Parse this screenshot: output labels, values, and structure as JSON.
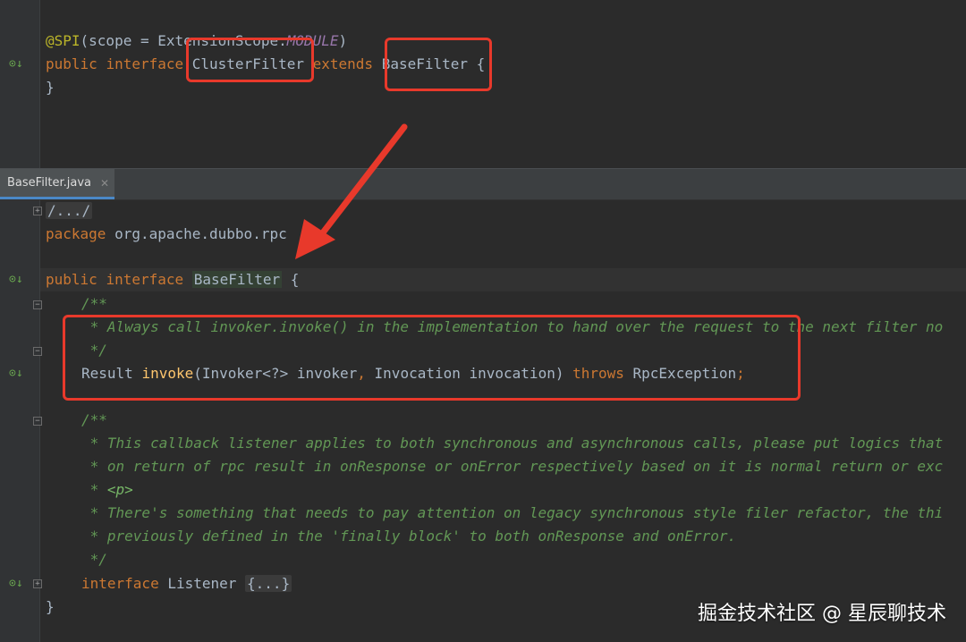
{
  "top_pane": {
    "line_annotation": {
      "at": "@SPI",
      "open": "(scope = ExtensionScope.",
      "field": "MODULE",
      "close": ")"
    },
    "line_decl": {
      "kw1": "public ",
      "kw2": "interface ",
      "name": "ClusterFilter",
      "kw3": " extends ",
      "parent": "BaseFilter",
      "brace": " {"
    },
    "line_close": "}"
  },
  "tab": {
    "label": "BaseFilter.java",
    "close_glyph": "✕"
  },
  "bottom_pane": {
    "collapsed_header": "/.../",
    "package_kw": "package ",
    "package_name": "org.apache.dubbo.rpc",
    "decl": {
      "kw1": "public ",
      "kw2": "interface ",
      "name": "BaseFilter",
      "brace": " {"
    },
    "doc1": {
      "open": "/**",
      "line1": " * Always call invoker.invoke() in the implementation to hand over the request to the next filter no",
      "close": " */"
    },
    "method": {
      "ret": "Result ",
      "name": "invoke",
      "params": "(Invoker<?> invoker",
      "comma": ",",
      "params2": " Invocation invocation) ",
      "throws_kw": "throws",
      "exc": " RpcException",
      "semi": ";"
    },
    "doc2": {
      "open": "/**",
      "line1": " * This callback listener applies to both synchronous and asynchronous calls, please put logics that",
      "line2": " * on return of rpc result in onResponse or onError respectively based on it is normal return or exc",
      "line3_star": " * ",
      "line3_tag": "<p>",
      "line4": " * There's something that needs to pay attention on legacy synchronous style filer refactor, the thi",
      "line5": " * previously defined in the 'finally block' to both onResponse and onError.",
      "close": " */"
    },
    "listener": {
      "kw": "interface ",
      "name": "Listener ",
      "folded": "{...}"
    },
    "close": "}"
  },
  "gutter_icons": {
    "implemented_icon": "⊙↓"
  },
  "watermark": "掘金技术社区 @ 星辰聊技术",
  "colors": {
    "editor_bg": "#2b2b2b",
    "keyword": "#cc7832",
    "annotation": "#bbb529",
    "doc_comment": "#629755",
    "method_name": "#ffc66d",
    "highlight_box": "#e8392b"
  }
}
